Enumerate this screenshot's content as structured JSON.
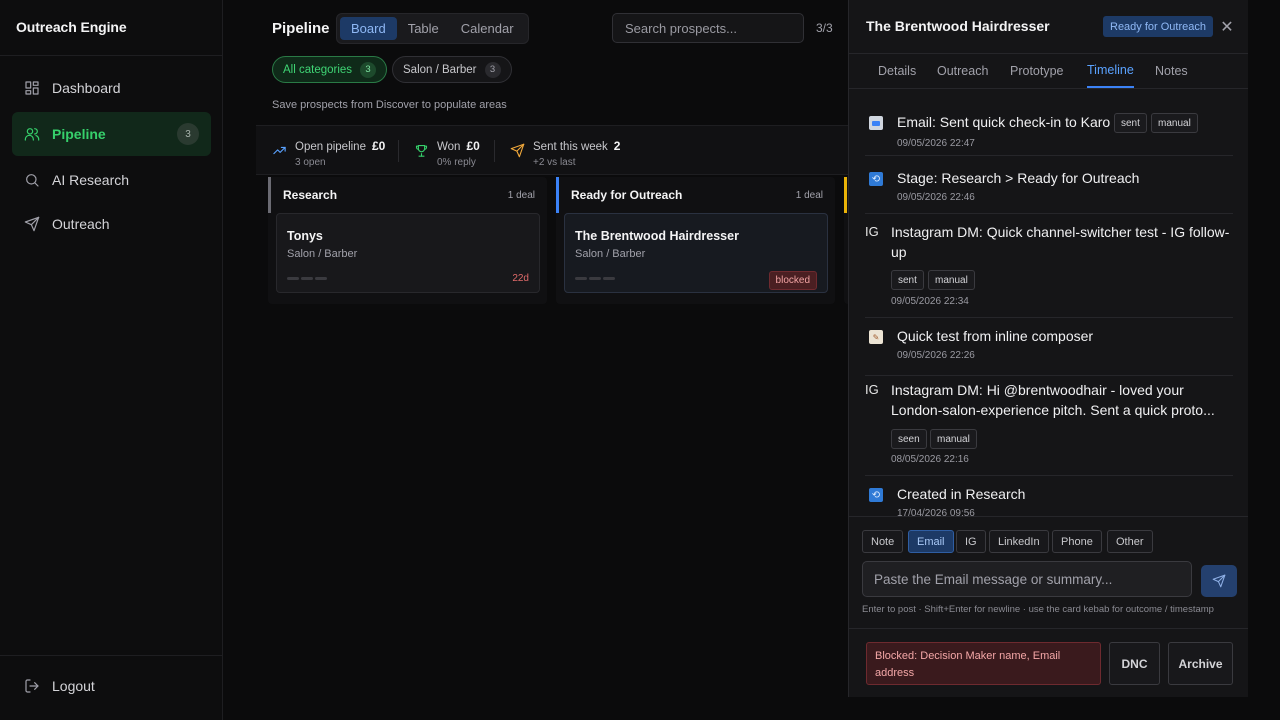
{
  "app": {
    "brand": "Outreach Engine"
  },
  "sidebar": {
    "items": [
      {
        "label": "Dashboard",
        "icon": "dashboard-icon"
      },
      {
        "label": "Pipeline",
        "icon": "users-icon",
        "badge": "3",
        "active": true
      },
      {
        "label": "AI Research",
        "icon": "search-icon"
      },
      {
        "label": "Outreach",
        "icon": "send-icon"
      }
    ],
    "logout": "Logout"
  },
  "main": {
    "title": "Pipeline",
    "view_tabs": [
      "Board",
      "Table",
      "Calendar"
    ],
    "active_view": "Board",
    "search_placeholder": "Search prospects...",
    "result_count": "3/3",
    "categories": [
      {
        "label": "All categories",
        "count": "3",
        "active": true
      },
      {
        "label": "Salon / Barber",
        "count": "3"
      }
    ],
    "hint": "Save prospects from Discover to populate areas",
    "stats": [
      {
        "label": "Open pipeline",
        "value": "£0",
        "sub": "3 open",
        "icon": "trend-up-icon",
        "color": "#5aa2ff"
      },
      {
        "label": "Won",
        "value": "£0",
        "sub": "0% reply",
        "icon": "trophy-icon",
        "color": "#36d06b"
      },
      {
        "label": "Sent this week",
        "value": "2",
        "sub": "+2 vs last",
        "icon": "send-icon",
        "color": "#f2a93b"
      }
    ],
    "columns": [
      {
        "title": "Research",
        "count": "1 deal",
        "accent": "#6b6b73",
        "card": {
          "title": "Tonys",
          "sub": "Salon / Barber",
          "age": "22d"
        }
      },
      {
        "title": "Ready for Outreach",
        "count": "1 deal",
        "accent": "#3b82f6",
        "card": {
          "title": "The Brentwood Hairdresser",
          "sub": "Salon / Barber",
          "tag": "blocked"
        }
      }
    ],
    "peek_accent": "#eab308"
  },
  "drawer": {
    "title": "The Brentwood Hairdresser",
    "stage": "Ready for Outreach",
    "tabs": [
      "Details",
      "Outreach",
      "Prototype",
      "Timeline",
      "Notes"
    ],
    "active_tab": "Timeline",
    "timeline": [
      {
        "kind": "email",
        "text": "Email: Sent quick check-in to Karo",
        "tags": [
          "sent",
          "manual"
        ],
        "time": "09/05/2026 22:47"
      },
      {
        "kind": "stage",
        "text": "Stage: Research > Ready for Outreach",
        "tags": [],
        "time": "09/05/2026 22:46"
      },
      {
        "kind": "ig",
        "ig_label": "IG",
        "text": "Instagram DM: Quick channel-switcher test - IG follow-up",
        "tags": [
          "sent",
          "manual"
        ],
        "time": "09/05/2026 22:34"
      },
      {
        "kind": "note",
        "text": "Quick test from inline composer",
        "tags": [],
        "time": "09/05/2026 22:26"
      },
      {
        "kind": "ig",
        "ig_label": "IG",
        "text": "Instagram DM: Hi @brentwoodhair - loved your London-salon-experience pitch. Sent a quick proto...",
        "tags": [
          "seen",
          "manual"
        ],
        "time": "08/05/2026 22:16"
      },
      {
        "kind": "stage",
        "text": "Created in Research",
        "tags": [],
        "time": "17/04/2026 09:56"
      }
    ],
    "composer": {
      "types": [
        "Note",
        "Email",
        "IG",
        "LinkedIn",
        "Phone",
        "Other"
      ],
      "active_type": "Email",
      "placeholder": "Paste the Email message or summary...",
      "hint": "Enter to post · Shift+Enter for newline · use the card kebab for outcome / timestamp"
    },
    "footer": {
      "blocked": "Blocked: Decision Maker name, Email address",
      "dnc": "DNC",
      "archive": "Archive"
    }
  }
}
